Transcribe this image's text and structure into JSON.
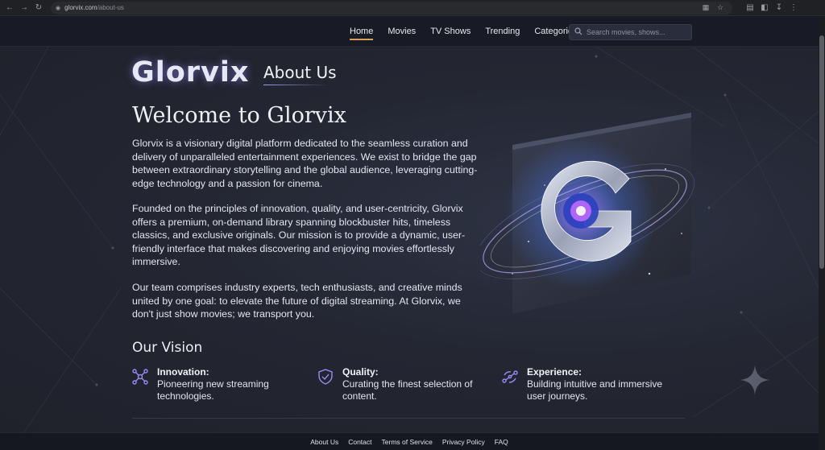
{
  "browser": {
    "url_domain": "glorvix.com",
    "url_path": "/about-us"
  },
  "nav": {
    "items": [
      {
        "label": "Home",
        "active": true
      },
      {
        "label": "Movies",
        "active": false
      },
      {
        "label": "TV Shows",
        "active": false
      },
      {
        "label": "Trending",
        "active": false
      },
      {
        "label": "Categories",
        "active": false
      }
    ],
    "search_placeholder": "Search movies, shows..."
  },
  "brand": {
    "logo_text": "Glorvix",
    "page_title": "About Us"
  },
  "content": {
    "heading": "Welcome to Glorvix",
    "paragraphs": [
      "Glorvix is a visionary digital platform dedicated to the seamless curation and delivery of unparalleled entertainment experiences. We exist to bridge the gap between extraordinary storytelling and the global audience, leveraging cutting-edge technology and a passion for cinema.",
      "Founded on the principles of innovation, quality, and user-centricity, Glorvix offers a premium, on-demand library spanning blockbuster hits, timeless classics, and exclusive originals. Our mission is to provide a dynamic, user-friendly interface that makes discovering and enjoying movies effortlessly immersive.",
      "Our team comprises industry experts, tech enthusiasts, and creative minds united by one goal: to elevate the future of digital streaming. At Glorvix, we don't just show movies; we transport you."
    ]
  },
  "vision": {
    "heading": "Our Vision",
    "items": [
      {
        "title": "Innovation:",
        "text": "Pioneering new streaming technologies.",
        "icon": "network-nodes-icon"
      },
      {
        "title": "Quality:",
        "text": "Curating the finest selection of content.",
        "icon": "shield-check-icon"
      },
      {
        "title": "Experience:",
        "text": "Building intuitive and immersive user journeys.",
        "icon": "user-journey-icon"
      }
    ]
  },
  "footer": {
    "links": [
      "About Us",
      "Contact",
      "Terms of Service",
      "Privacy Policy",
      "FAQ"
    ]
  },
  "colors": {
    "background": "#1d1f27",
    "header": "#181b25",
    "accent_underline": "#d6a05a",
    "icon_accent": "#9a8cf5"
  }
}
